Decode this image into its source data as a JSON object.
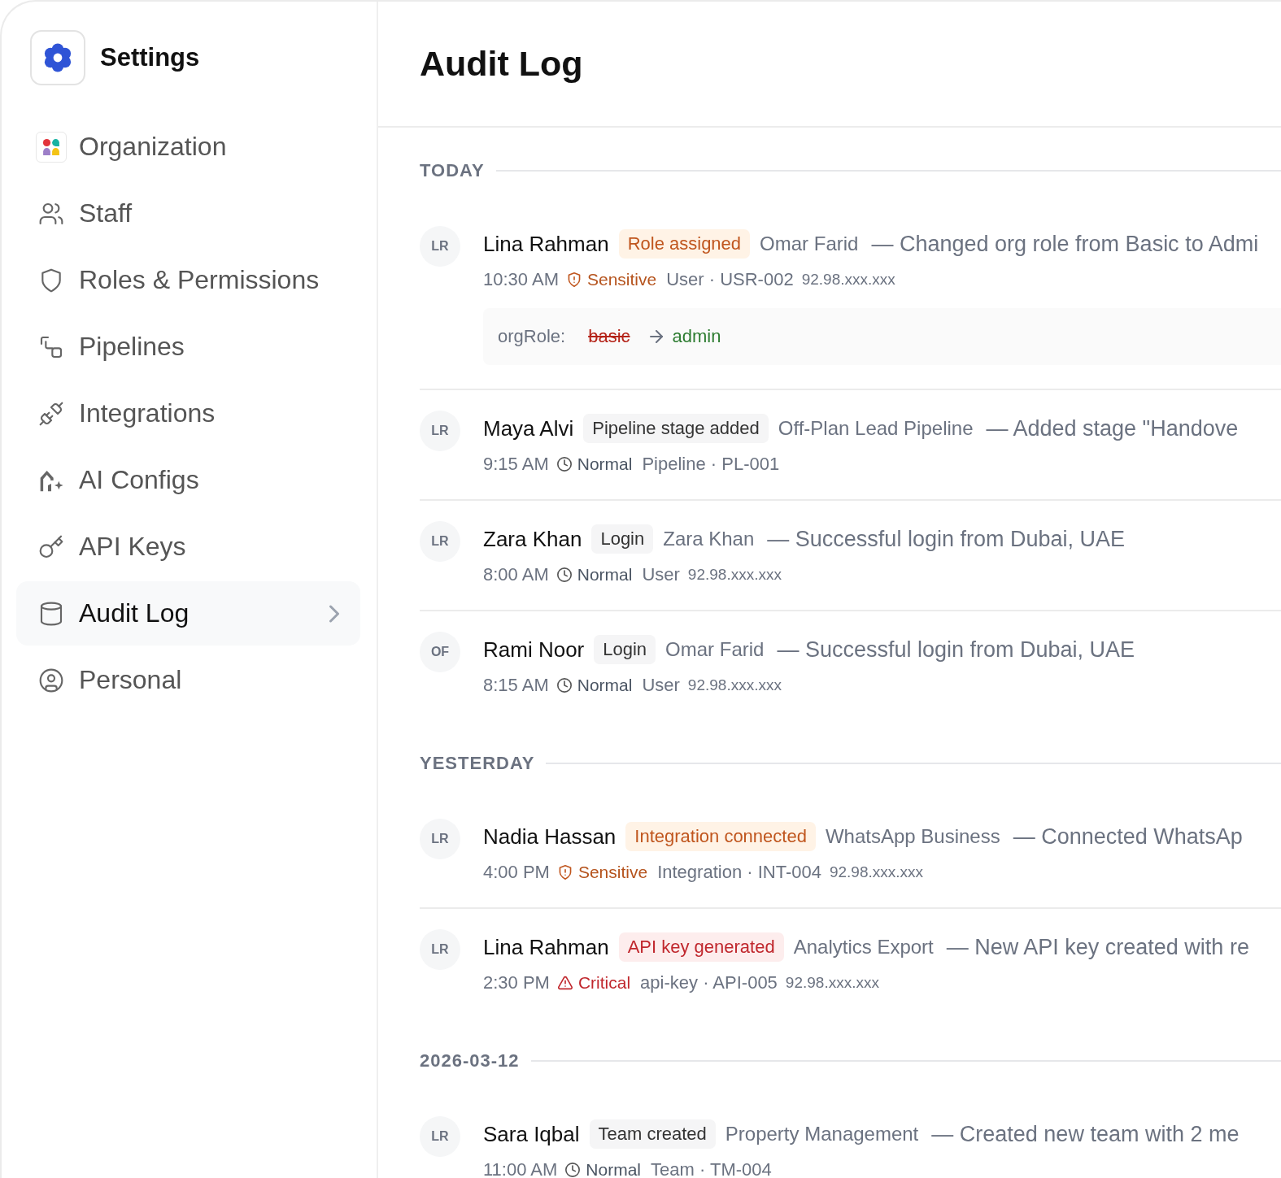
{
  "sidebar": {
    "title": "Settings",
    "items": [
      {
        "label": "Organization",
        "selected": false
      },
      {
        "label": "Staff",
        "selected": false
      },
      {
        "label": "Roles & Permissions",
        "selected": false
      },
      {
        "label": "Pipelines",
        "selected": false
      },
      {
        "label": "Integrations",
        "selected": false
      },
      {
        "label": "AI Configs",
        "selected": false
      },
      {
        "label": "API Keys",
        "selected": false
      },
      {
        "label": "Audit Log",
        "selected": true
      },
      {
        "label": "Personal",
        "selected": false
      }
    ]
  },
  "header": {
    "title": "Audit Log"
  },
  "sections": [
    {
      "label": "TODAY",
      "entries": [
        {
          "initials": "LR",
          "name": "Lina Rahman",
          "badge": "Role assigned",
          "target": "Omar Farid",
          "description": "— Changed org role from Basic to Admi",
          "time": "10:30 AM",
          "severity": {
            "kind": "sensitive",
            "label": "Sensitive"
          },
          "resource": "User · USR-002",
          "ip": "92.98.xxx.xxx",
          "changes": [
            {
              "field": "orgRole:",
              "from": "basic",
              "to": "admin"
            }
          ]
        },
        {
          "initials": "LR",
          "name": "Maya Alvi",
          "badge": "Pipeline stage added",
          "target": "Off-Plan Lead Pipeline",
          "description": "— Added stage \"Handove",
          "time": "9:15 AM",
          "severity": {
            "kind": "normal",
            "label": "Normal"
          },
          "resource": "Pipeline · PL-001"
        },
        {
          "initials": "LR",
          "name": "Zara Khan",
          "badge": "Login",
          "target": "Zara Khan",
          "description": "— Successful login from Dubai, UAE",
          "time": "8:00 AM",
          "severity": {
            "kind": "normal",
            "label": "Normal"
          },
          "resource": "User",
          "ip": "92.98.xxx.xxx"
        },
        {
          "initials": "OF",
          "name": "Rami Noor",
          "badge": "Login",
          "target": "Omar Farid",
          "description": "— Successful login from Dubai, UAE",
          "time": "8:15 AM",
          "severity": {
            "kind": "normal",
            "label": "Normal"
          },
          "resource": "User",
          "ip": "92.98.xxx.xxx"
        }
      ]
    },
    {
      "label": "YESTERDAY",
      "entries": [
        {
          "initials": "LR",
          "name": "Nadia Hassan",
          "badge": "Integration connected",
          "target": "WhatsApp Business",
          "description": "— Connected WhatsAp",
          "time": "4:00 PM",
          "severity": {
            "kind": "sensitive",
            "label": "Sensitive"
          },
          "resource": "Integration · INT-004",
          "ip": "92.98.xxx.xxx"
        },
        {
          "initials": "LR",
          "name": "Lina Rahman",
          "badge": "API key generated",
          "target": "Analytics Export",
          "description": "— New API key created with re",
          "time": "2:30 PM",
          "severity": {
            "kind": "critical",
            "label": "Critical"
          },
          "resource": "api-key · API-005",
          "ip": "92.98.xxx.xxx"
        }
      ]
    },
    {
      "label": "2026-03-12",
      "entries": [
        {
          "initials": "LR",
          "name": "Sara Iqbal",
          "badge": "Team created",
          "target": "Property Management",
          "description": "— Created new team with 2 me",
          "time": "11:00 AM",
          "severity": {
            "kind": "normal",
            "label": "Normal"
          },
          "resource": "Team · TM-004"
        }
      ]
    }
  ]
}
